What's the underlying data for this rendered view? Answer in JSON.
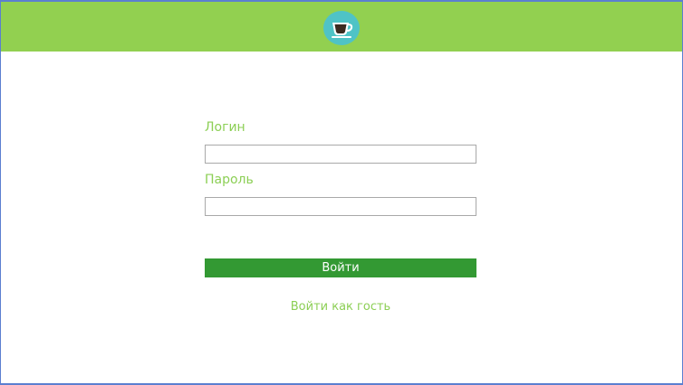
{
  "header": {
    "logo_icon": "coffee-cup-icon",
    "background_color": "#92d050",
    "logo_circle_color": "#4fc3c6"
  },
  "login_form": {
    "login_label": "Логин",
    "login_value": "",
    "password_label": "Пароль",
    "password_value": "",
    "submit_label": "Войти",
    "guest_link": "Войти как гость",
    "label_color": "#8ccf55",
    "button_color": "#339933"
  }
}
